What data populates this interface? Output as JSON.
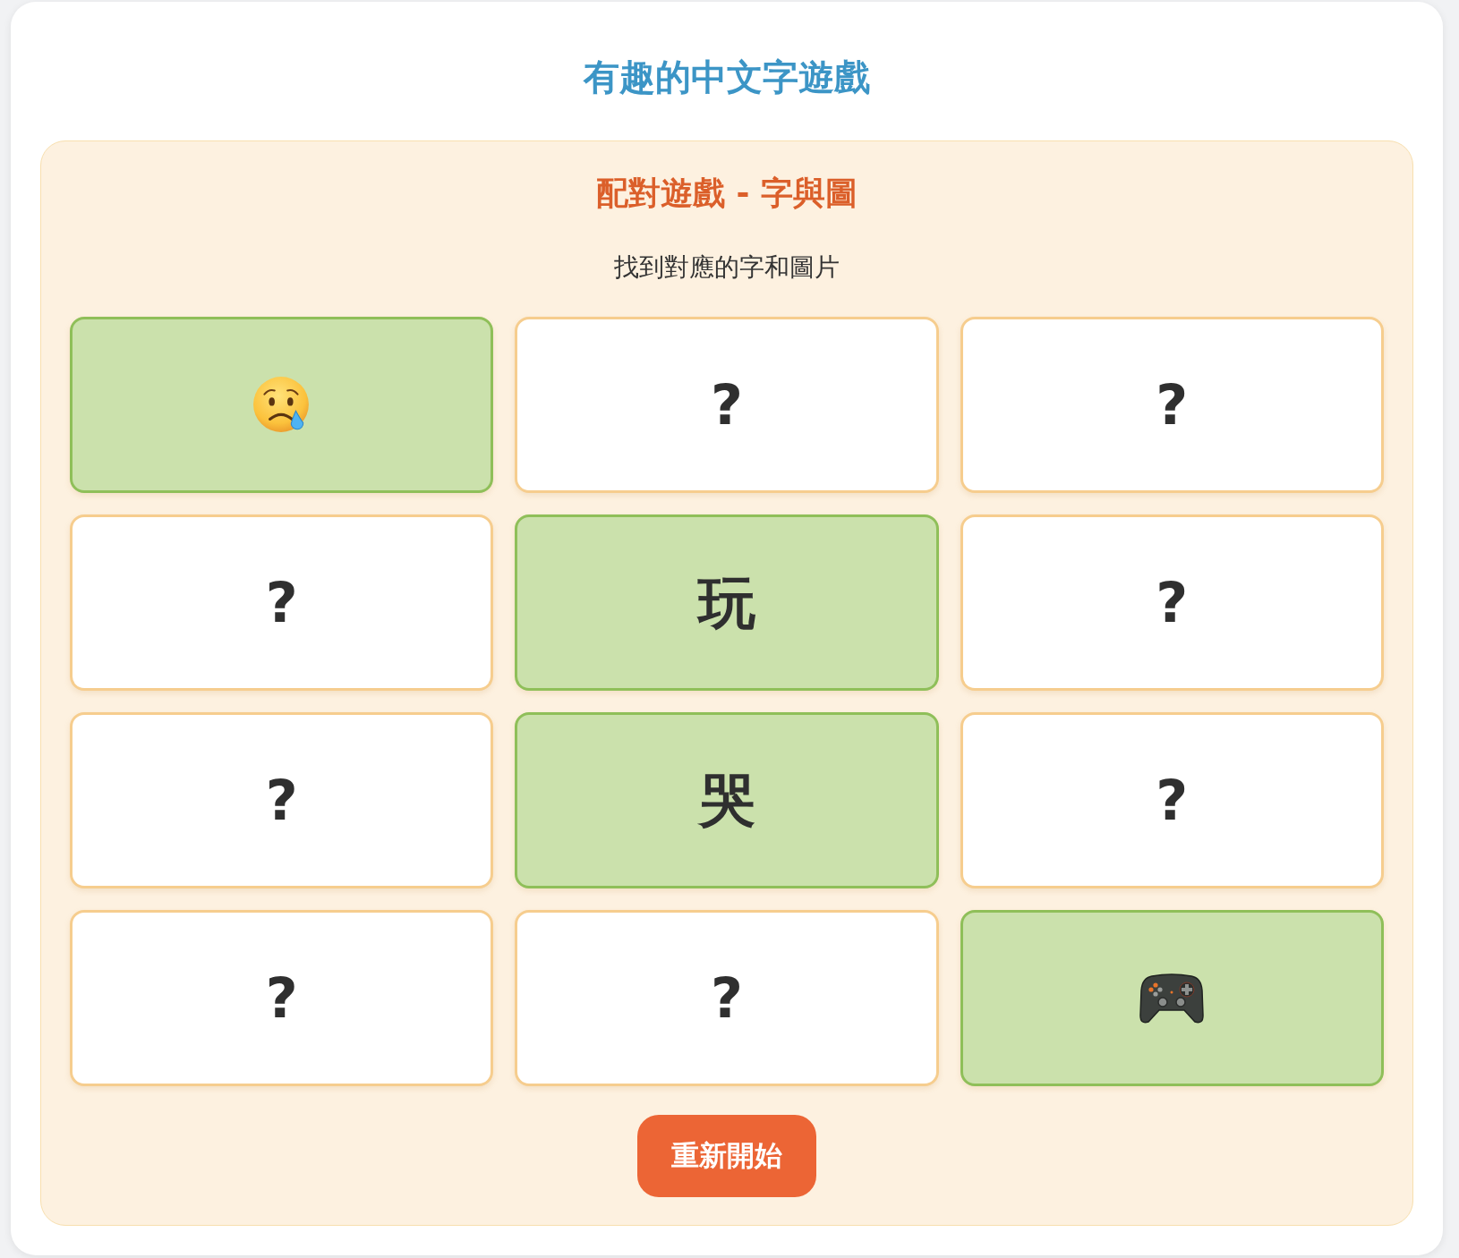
{
  "title": "有趣的中文字遊戲",
  "game": {
    "title": "配對遊戲 - 字與圖",
    "instruction": "找到對應的字和圖片",
    "cards": [
      {
        "kind": "picture",
        "matched": true
      },
      {
        "kind": "hidden",
        "text": "?",
        "matched": false
      },
      {
        "kind": "hidden",
        "text": "?",
        "matched": false
      },
      {
        "kind": "hidden",
        "text": "?",
        "matched": false
      },
      {
        "kind": "character",
        "text": "玩",
        "matched": true
      },
      {
        "kind": "hidden",
        "text": "?",
        "matched": false
      },
      {
        "kind": "hidden",
        "text": "?",
        "matched": false
      },
      {
        "kind": "character",
        "text": "哭",
        "matched": true
      },
      {
        "kind": "hidden",
        "text": "?",
        "matched": false
      },
      {
        "kind": "hidden",
        "text": "?",
        "matched": false
      },
      {
        "kind": "hidden",
        "text": "?",
        "matched": false
      },
      {
        "kind": "picture",
        "matched": true
      }
    ],
    "restart_button": "重新開始"
  }
}
